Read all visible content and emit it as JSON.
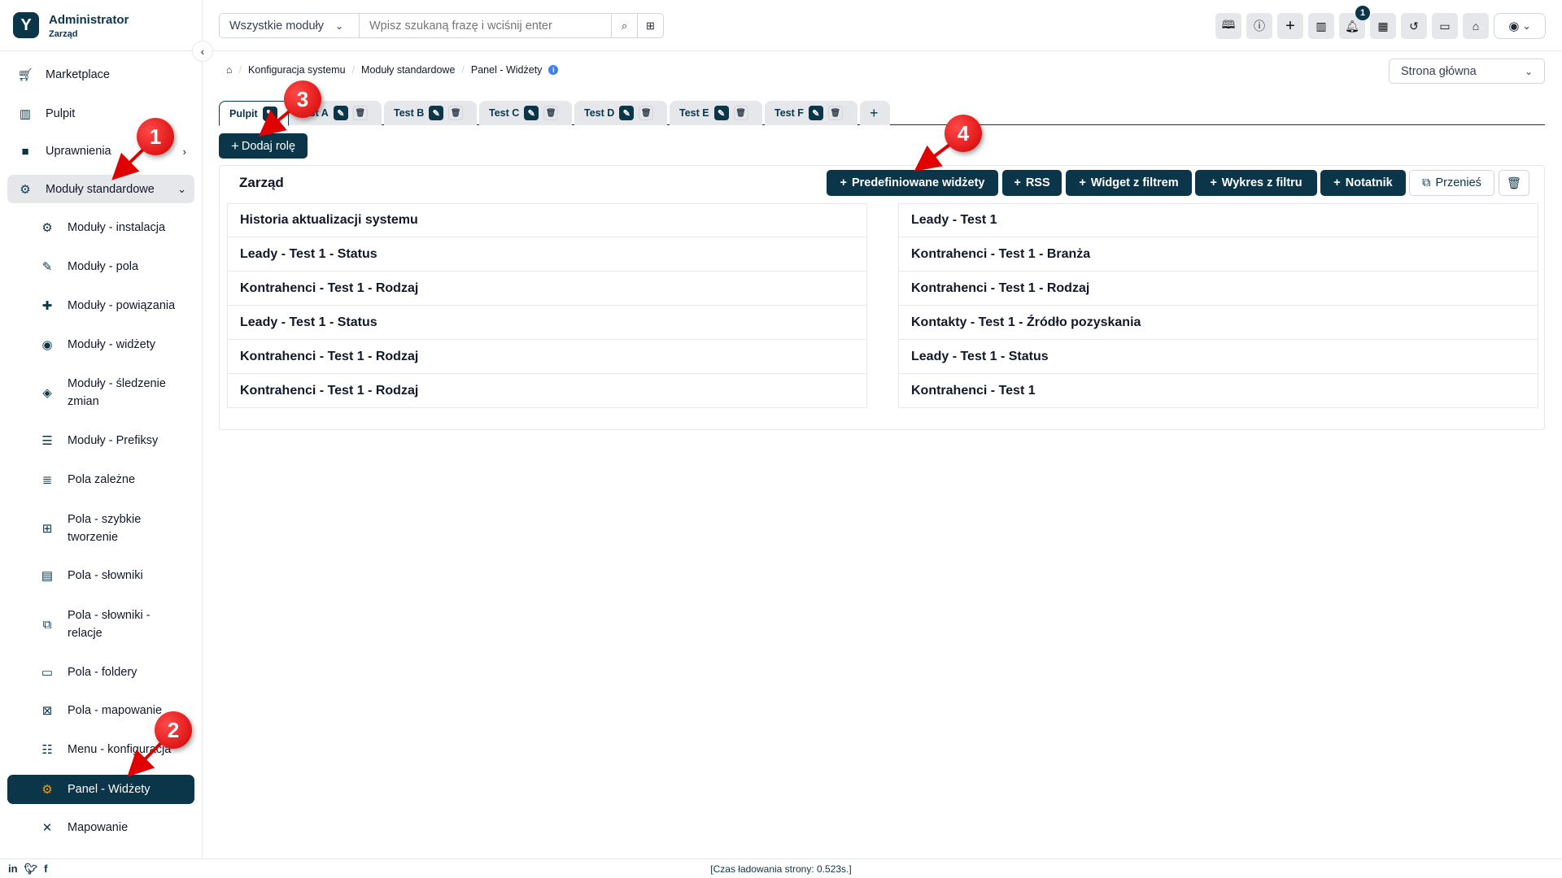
{
  "user": {
    "name": "Administrator",
    "role": "Zarząd"
  },
  "sidebar": {
    "items": [
      {
        "label": "Marketplace",
        "icon": "cart-icon"
      },
      {
        "label": "Pulpit",
        "icon": "dashboard-icon"
      },
      {
        "label": "Uprawnienia",
        "icon": "briefcase-icon"
      },
      {
        "label": "Moduły standardowe",
        "icon": "modules-icon"
      },
      {
        "label": "Moduły - instalacja",
        "icon": "gears-icon"
      },
      {
        "label": "Moduły - pola",
        "icon": "puzzle-icon"
      },
      {
        "label": "Moduły - powiązania",
        "icon": "puzzle-link-icon"
      },
      {
        "label": "Moduły - widżety",
        "icon": "puzzle-widget-icon"
      },
      {
        "label": "Moduły - śledzenie zmian",
        "icon": "puzzle-history-icon"
      },
      {
        "label": "Moduły - Prefiksy",
        "icon": "list-prefix-icon"
      },
      {
        "label": "Pola zależne",
        "icon": "list-icon"
      },
      {
        "label": "Pola - szybkie tworzenie",
        "icon": "plus-square-icon"
      },
      {
        "label": "Pola - słowniki",
        "icon": "table-icon"
      },
      {
        "label": "Pola - słowniki - relacje",
        "icon": "relations-icon"
      },
      {
        "label": "Pola - foldery",
        "icon": "folder-icon"
      },
      {
        "label": "Pola - mapowanie",
        "icon": "mapping-icon"
      },
      {
        "label": "Menu - konfiguracja",
        "icon": "menu-list-icon"
      },
      {
        "label": "Panel - Widżety",
        "icon": "widget-gear-icon"
      },
      {
        "label": "Mapowanie",
        "icon": "arrows-icon"
      }
    ]
  },
  "search": {
    "module_select": "Wszystkie moduły",
    "placeholder": "Wpisz szukaną frazę i wciśnij enter"
  },
  "toolbar": {
    "icons": [
      "book-icon",
      "info-icon",
      "plus-icon",
      "library-icon",
      "bell-icon",
      "calendar-icon",
      "history-icon",
      "video-icon",
      "home-icon"
    ],
    "notification_count": "1"
  },
  "breadcrumb": [
    "Konfiguracja systemu",
    "Moduły standardowe",
    "Panel - Widżety"
  ],
  "page_select": "Strona główna",
  "tabs": [
    {
      "label": "Pulpit"
    },
    {
      "label": "Test A"
    },
    {
      "label": "Test B"
    },
    {
      "label": "Test C"
    },
    {
      "label": "Test D"
    },
    {
      "label": "Test E"
    },
    {
      "label": "Test F"
    }
  ],
  "add_tab": "+",
  "add_role": "Dodaj rolę",
  "panel": {
    "title": "Zarząd",
    "buttons": {
      "predefined": "Predefiniowane widżety",
      "rss": "RSS",
      "widget_filter": "Widget z filtrem",
      "chart_filter": "Wykres z filtru",
      "notepad": "Notatnik",
      "move": "Przenieś"
    },
    "left": [
      "Historia aktualizacji systemu",
      "Leady - Test 1 - Status",
      "Kontrahenci - Test 1 - Rodzaj",
      "Leady - Test 1 - Status",
      "Kontrahenci - Test 1 - Rodzaj",
      "Kontrahenci - Test 1 - Rodzaj"
    ],
    "right": [
      "Leady - Test 1",
      "Kontrahenci - Test 1 - Branża",
      "Kontrahenci - Test 1 - Rodzaj",
      "Kontakty - Test 1 - Źródło pozyskania",
      "Leady - Test 1 - Status",
      "Kontrahenci - Test 1"
    ]
  },
  "footer": {
    "load_time": "[Czas ładowania strony: 0.523s.]",
    "social": [
      "linkedin-icon",
      "twitter-icon",
      "facebook-icon"
    ]
  },
  "annotations": [
    "1",
    "2",
    "3",
    "4"
  ],
  "colors": {
    "primary": "#0b3548",
    "annotation": "#e00000",
    "accent": "#f59e0b"
  }
}
